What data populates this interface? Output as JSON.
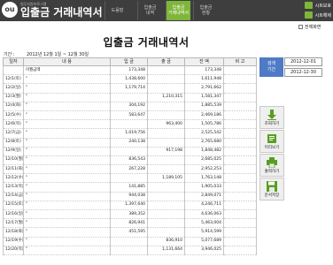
{
  "header": {
    "subtitle": "범무지원프로그램",
    "title": "입출금 거래내역서",
    "logo_glyph": "ou",
    "tabs": [
      {
        "lines": [
          "도움말"
        ],
        "active": false
      },
      {
        "lines": [
          "입출금",
          "내역"
        ],
        "active": false
      },
      {
        "lines": [
          "입출금",
          "거래내역서"
        ],
        "active": true
      },
      {
        "lines": [
          "입출금",
          "현황"
        ],
        "active": false
      }
    ],
    "side_links": [
      "시트보호",
      "시트해제"
    ]
  },
  "report": {
    "title": "입출금 거래내역서",
    "period_label": "기간 :",
    "period_value": "2012년 12월 1일 ~ 12월 30일",
    "show_all_label": "전체화면"
  },
  "table": {
    "headers": [
      "일자",
      "내 용",
      "입 금",
      "출 금",
      "잔 액",
      "비 고"
    ],
    "rows": [
      [
        "",
        "이월금액",
        "173,348",
        "",
        "173,348",
        ""
      ],
      [
        "12/1(토)",
        "\"",
        "1,438,600",
        "",
        "1,611,948",
        ""
      ],
      [
        "12/2(일)",
        "\"",
        "1,179,714",
        "",
        "2,791,662",
        ""
      ],
      [
        "12/3(월)",
        "\"",
        "",
        "1,210,315",
        "1,581,347",
        ""
      ],
      [
        "12/4(화)",
        "\"",
        "304,192",
        "",
        "1,885,539",
        ""
      ],
      [
        "12/5(수)",
        "\"",
        "583,647",
        "",
        "2,469,186",
        ""
      ],
      [
        "12/6(목)",
        "\"",
        "",
        "963,400",
        "1,505,786",
        ""
      ],
      [
        "12/7(금)",
        "\"",
        "1,019,756",
        "",
        "2,525,542",
        ""
      ],
      [
        "12/8(토)",
        "\"",
        "240,138",
        "",
        "2,765,680",
        ""
      ],
      [
        "12/9(일)",
        "\"",
        "",
        "917,198",
        "1,848,482",
        ""
      ],
      [
        "12/10(월)",
        "\"",
        "836,543",
        "",
        "2,685,025",
        ""
      ],
      [
        "12/11(화)",
        "\"",
        "267,228",
        "",
        "2,952,253",
        ""
      ],
      [
        "12/12(수)",
        "\"",
        "",
        "1,189,105",
        "1,763,148",
        ""
      ],
      [
        "12/13(목)",
        "\"",
        "141,885",
        "",
        "1,905,033",
        ""
      ],
      [
        "12/14(금)",
        "\"",
        "944,038",
        "",
        "2,849,071",
        ""
      ],
      [
        "12/15(토)",
        "\"",
        "1,397,640",
        "",
        "4,246,711",
        ""
      ],
      [
        "12/16(일)",
        "\"",
        "389,352",
        "",
        "4,636,063",
        ""
      ],
      [
        "12/17(월)",
        "\"",
        "826,941",
        "",
        "5,463,004",
        ""
      ],
      [
        "12/18(화)",
        "\"",
        "451,595",
        "",
        "5,914,599",
        ""
      ],
      [
        "12/19(수)",
        "\"",
        "",
        "836,910",
        "5,077,689",
        ""
      ],
      [
        "12/20(목)",
        "\"",
        "",
        "1,131,664",
        "3,946,025",
        ""
      ]
    ]
  },
  "panel": {
    "label_lines": [
      "검색",
      "기간"
    ],
    "date_from": "2012-12-01",
    "date_to": "2012-12-30",
    "buttons": [
      {
        "label": "조회하기",
        "icon": "download-arrow-icon"
      },
      {
        "label": "미리보기",
        "icon": "preview-icon"
      },
      {
        "label": "출력하기",
        "icon": "printer-icon"
      },
      {
        "label": "문서저장",
        "icon": "save-disk-icon"
      }
    ]
  },
  "colors": {
    "header_bg": "#3e3e3e",
    "accent_green": "#7fb53a",
    "label_blue": "#4f7ac6"
  }
}
